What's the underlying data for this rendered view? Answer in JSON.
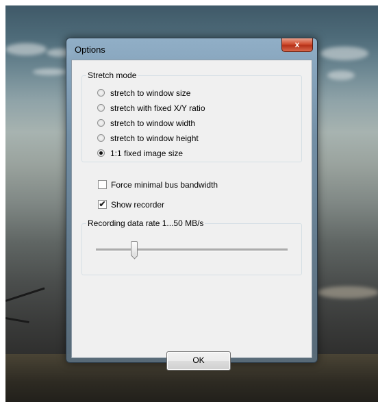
{
  "window": {
    "title": "Options",
    "close_glyph": "x"
  },
  "stretch_mode": {
    "label": "Stretch mode",
    "options": [
      {
        "label": "stretch to window size",
        "checked": false
      },
      {
        "label": "stretch with fixed X/Y ratio",
        "checked": false
      },
      {
        "label": "stretch to window width",
        "checked": false
      },
      {
        "label": "stretch to window height",
        "checked": false
      },
      {
        "label": "1:1 fixed image size",
        "checked": true
      }
    ]
  },
  "checkboxes": {
    "force_min_bandwidth": {
      "label": "Force minimal bus bandwidth",
      "checked": false
    },
    "show_recorder": {
      "label": "Show recorder",
      "checked": true,
      "glyph": "✔"
    }
  },
  "recording": {
    "label": "Recording data rate 1...50 MB/s",
    "slider_fraction": 0.2
  },
  "buttons": {
    "ok_label": "OK"
  }
}
